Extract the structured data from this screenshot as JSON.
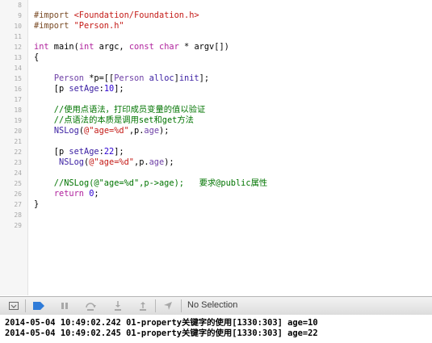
{
  "editor": {
    "lines": [
      {
        "n": "8",
        "segs": []
      },
      {
        "n": "9",
        "segs": [
          {
            "t": "#import ",
            "c": "pre"
          },
          {
            "t": "<Foundation/Foundation.h>",
            "c": "str"
          }
        ]
      },
      {
        "n": "10",
        "segs": [
          {
            "t": "#import ",
            "c": "pre"
          },
          {
            "t": "\"Person.h\"",
            "c": "str"
          }
        ]
      },
      {
        "n": "11",
        "segs": []
      },
      {
        "n": "12",
        "segs": [
          {
            "t": "int",
            "c": "kw"
          },
          {
            "t": " main(",
            "c": ""
          },
          {
            "t": "int",
            "c": "kw"
          },
          {
            "t": " argc, ",
            "c": ""
          },
          {
            "t": "const",
            "c": "kw"
          },
          {
            "t": " ",
            "c": ""
          },
          {
            "t": "char",
            "c": "kw"
          },
          {
            "t": " * argv[])",
            "c": ""
          }
        ]
      },
      {
        "n": "13",
        "segs": [
          {
            "t": "{",
            "c": ""
          }
        ]
      },
      {
        "n": "14",
        "segs": []
      },
      {
        "n": "15",
        "segs": [
          {
            "t": "    ",
            "c": ""
          },
          {
            "t": "Person",
            "c": "cls"
          },
          {
            "t": " *p=[[",
            "c": ""
          },
          {
            "t": "Person",
            "c": "cls"
          },
          {
            "t": " ",
            "c": ""
          },
          {
            "t": "alloc",
            "c": "fn"
          },
          {
            "t": "]",
            "c": ""
          },
          {
            "t": "init",
            "c": "fn"
          },
          {
            "t": "];",
            "c": ""
          }
        ]
      },
      {
        "n": "16",
        "segs": [
          {
            "t": "    [p ",
            "c": ""
          },
          {
            "t": "setAge",
            "c": "fn"
          },
          {
            "t": ":",
            "c": ""
          },
          {
            "t": "10",
            "c": "num"
          },
          {
            "t": "];",
            "c": ""
          }
        ]
      },
      {
        "n": "17",
        "segs": []
      },
      {
        "n": "18",
        "segs": [
          {
            "t": "    //使用点语法，打印成员变量的值以验证",
            "c": "cmt"
          }
        ]
      },
      {
        "n": "19",
        "segs": [
          {
            "t": "    //点语法的本质是调用set和get方法",
            "c": "cmt"
          }
        ]
      },
      {
        "n": "20",
        "segs": [
          {
            "t": "    ",
            "c": ""
          },
          {
            "t": "NSLog",
            "c": "fn"
          },
          {
            "t": "(",
            "c": ""
          },
          {
            "t": "@\"age=%d\"",
            "c": "str"
          },
          {
            "t": ",p.",
            "c": ""
          },
          {
            "t": "age",
            "c": "cls"
          },
          {
            "t": ");",
            "c": ""
          }
        ]
      },
      {
        "n": "21",
        "segs": []
      },
      {
        "n": "22",
        "segs": [
          {
            "t": "    [p ",
            "c": ""
          },
          {
            "t": "setAge",
            "c": "fn"
          },
          {
            "t": ":",
            "c": ""
          },
          {
            "t": "22",
            "c": "num"
          },
          {
            "t": "];",
            "c": ""
          }
        ]
      },
      {
        "n": "23",
        "segs": [
          {
            "t": "     ",
            "c": ""
          },
          {
            "t": "NSLog",
            "c": "fn"
          },
          {
            "t": "(",
            "c": ""
          },
          {
            "t": "@\"age=%d\"",
            "c": "str"
          },
          {
            "t": ",p.",
            "c": ""
          },
          {
            "t": "age",
            "c": "cls"
          },
          {
            "t": ");",
            "c": ""
          }
        ]
      },
      {
        "n": "24",
        "segs": []
      },
      {
        "n": "25",
        "segs": [
          {
            "t": "    //NSLog(@\"age=%d\",p->age);   要求@public属性",
            "c": "cmt"
          }
        ]
      },
      {
        "n": "26",
        "segs": [
          {
            "t": "    ",
            "c": ""
          },
          {
            "t": "return",
            "c": "kw"
          },
          {
            "t": " ",
            "c": ""
          },
          {
            "t": "0",
            "c": "num"
          },
          {
            "t": ";",
            "c": ""
          }
        ]
      },
      {
        "n": "27",
        "segs": [
          {
            "t": "}",
            "c": ""
          }
        ]
      },
      {
        "n": "28",
        "segs": []
      },
      {
        "n": "29",
        "segs": []
      }
    ]
  },
  "debug_bar": {
    "buttons": [
      {
        "name": "hide-debug-area-icon",
        "interactable": true
      },
      {
        "name": "breakpoints-toggle-icon",
        "interactable": true
      },
      {
        "name": "pause-icon",
        "interactable": true
      },
      {
        "name": "step-over-icon",
        "interactable": true
      },
      {
        "name": "step-into-icon",
        "interactable": true
      },
      {
        "name": "step-out-icon",
        "interactable": true
      },
      {
        "name": "location-icon",
        "interactable": true
      }
    ],
    "selection_label": "No Selection",
    "accent_color": "#2f7bd8"
  },
  "console": {
    "lines": [
      "2014-05-04 10:49:02.242 01-property关键字的使用[1330:303] age=10",
      "2014-05-04 10:49:02.245 01-property关键字的使用[1330:303] age=22"
    ]
  }
}
